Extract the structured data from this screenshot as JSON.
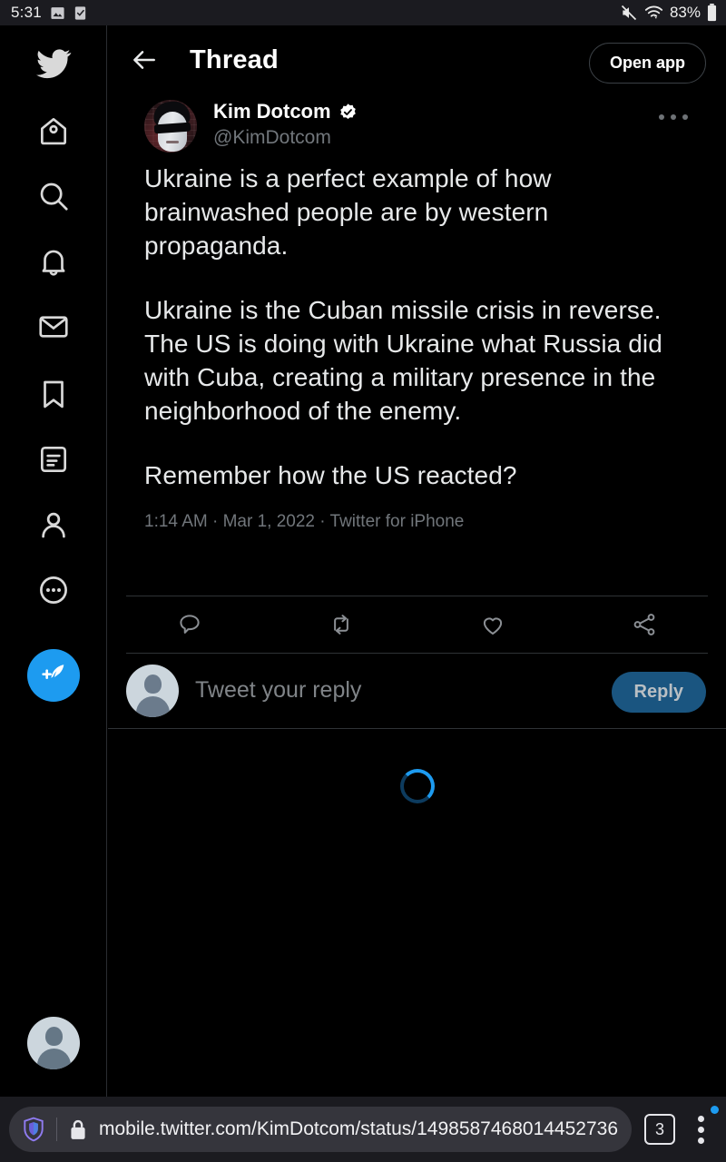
{
  "status_bar": {
    "time": "5:31",
    "battery_percent": "83%",
    "icons": [
      "image-icon",
      "checkbox-icon",
      "mute-icon",
      "wifi-icon",
      "battery-icon"
    ]
  },
  "sidebar": {
    "logo": "twitter-bird-logo",
    "items": [
      {
        "name": "home",
        "icon": "home-icon"
      },
      {
        "name": "search",
        "icon": "search-icon"
      },
      {
        "name": "notifications",
        "icon": "bell-icon"
      },
      {
        "name": "messages",
        "icon": "envelope-icon"
      },
      {
        "name": "bookmarks",
        "icon": "bookmark-icon"
      },
      {
        "name": "lists",
        "icon": "list-icon"
      },
      {
        "name": "profile",
        "icon": "person-icon"
      },
      {
        "name": "more",
        "icon": "more-circle-icon"
      }
    ],
    "compose": {
      "icon": "compose-feather-icon",
      "color": "#1d9bf0"
    },
    "account_avatar": "default-avatar-icon"
  },
  "header": {
    "back_icon": "back-arrow-icon",
    "title": "Thread",
    "open_app_label": "Open app"
  },
  "tweet": {
    "avatar": "kim-dotcom-avatar",
    "display_name": "Kim Dotcom",
    "verified_icon": "verified-badge-icon",
    "handle": "@KimDotcom",
    "more_icon": "more-horizontal-icon",
    "paragraphs": [
      "Ukraine is a perfect example of how brainwashed people are by western propaganda.",
      "Ukraine is the Cuban missile crisis in reverse. The US is doing with Ukraine what Russia did with Cuba, creating a military presence in the neighborhood of the enemy.",
      "Remember how the US reacted?"
    ],
    "meta": "1:14 AM · Mar 1, 2022 · Twitter for iPhone",
    "actions": [
      {
        "name": "reply",
        "icon": "comment-icon",
        "count": ""
      },
      {
        "name": "retweet",
        "icon": "retweet-icon",
        "count": ""
      },
      {
        "name": "like",
        "icon": "heart-icon",
        "count": ""
      },
      {
        "name": "share",
        "icon": "share-icon",
        "count": ""
      }
    ]
  },
  "reply_box": {
    "avatar": "default-avatar-icon",
    "placeholder": "Tweet your reply",
    "value": "",
    "button_label": "Reply",
    "button_color": "#1a5580"
  },
  "loading": {
    "spinner_icon": "loading-spinner-icon",
    "spinner_color": "#1d9bf0",
    "spinner_track_color": "#0d3b5e"
  },
  "browser_bar": {
    "shield_icon": "shield-icon",
    "lock_icon": "lock-icon",
    "url": "mobile.twitter.com/KimDotcom/status/1498587468014452736",
    "tab_count": "3",
    "menu_icon": "kebab-menu-icon",
    "menu_badge_color": "#1d9bf0"
  },
  "theme": {
    "background": "#000000",
    "status_bar_bg": "#1b1b20",
    "text_primary": "#e7e9ea",
    "text_secondary": "#71767b",
    "accent": "#1d9bf0",
    "divider": "#2f3336"
  }
}
